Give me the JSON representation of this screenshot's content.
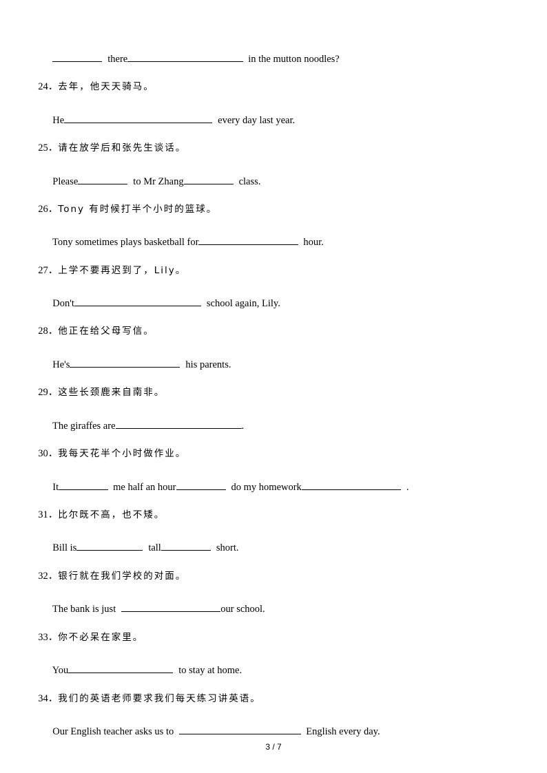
{
  "document": {
    "continuation": {
      "parts": [
        "",
        "there",
        "in the mutton noodles?"
      ]
    },
    "questions": [
      {
        "number": "24",
        "prompt": "去年，他天天骑马。",
        "sentence": [
          "He",
          "every day last year."
        ]
      },
      {
        "number": "25",
        "prompt": "请在放学后和张先生谈话。",
        "sentence": [
          "Please",
          "to Mr Zhang",
          "class."
        ]
      },
      {
        "number": "26",
        "prompt": "Tony 有时候打半个小时的篮球。",
        "sentence": [
          "Tony sometimes plays basketball for",
          "hour."
        ]
      },
      {
        "number": "27",
        "prompt": "上学不要再迟到了，Lily。",
        "sentence": [
          "Don't",
          "school again, Lily."
        ]
      },
      {
        "number": "28",
        "prompt": "他正在给父母写信。",
        "sentence": [
          "He's",
          "his parents."
        ]
      },
      {
        "number": "29",
        "prompt": "这些长颈鹿来自南非。",
        "sentence": [
          "The giraffes are",
          "."
        ]
      },
      {
        "number": "30",
        "prompt": "我每天花半个小时做作业。",
        "sentence": [
          "It",
          "me half an hour",
          "do my homework",
          "."
        ]
      },
      {
        "number": "31",
        "prompt": "比尔既不高，也不矮。",
        "sentence": [
          "Bill is",
          "tall",
          "short."
        ]
      },
      {
        "number": "32",
        "prompt": "银行就在我们学校的对面。",
        "sentence": [
          "The bank is just",
          "our school."
        ]
      },
      {
        "number": "33",
        "prompt": "你不必呆在家里。",
        "sentence": [
          "You",
          "to stay at home."
        ]
      },
      {
        "number": "34",
        "prompt": "我们的英语老师要求我们每天练习讲英语。",
        "sentence": [
          "Our English teacher asks us to",
          "English every day."
        ]
      }
    ],
    "number_separator": "．"
  },
  "footer": {
    "page_indicator": "3 / 7"
  }
}
